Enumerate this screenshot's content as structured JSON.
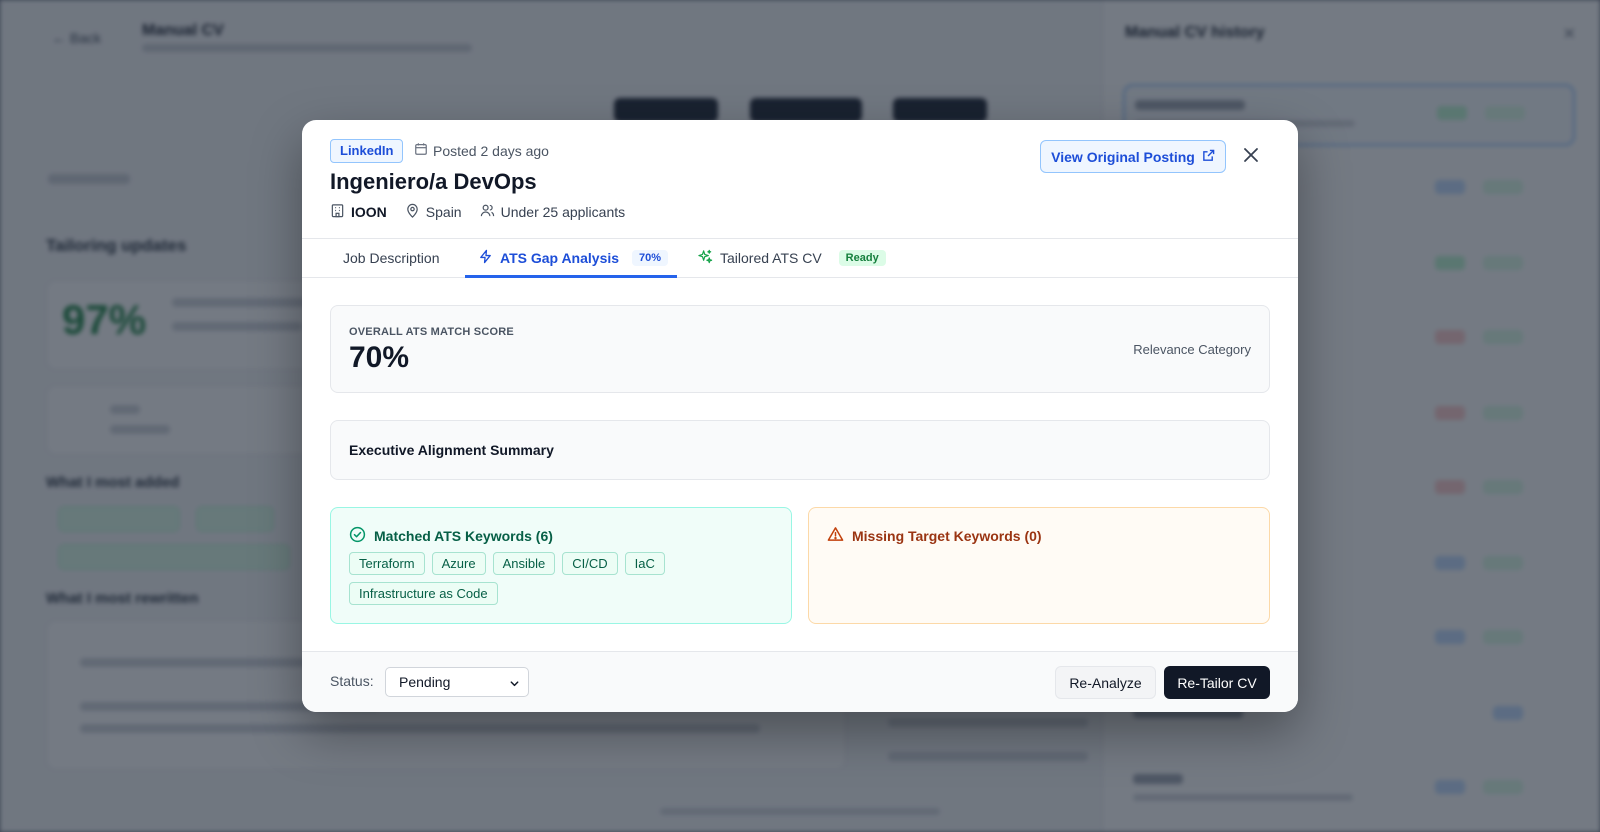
{
  "modal": {
    "source_badge": "LinkedIn",
    "posted": "Posted 2 days ago",
    "job_title": "Ingeniero/a DevOps",
    "company": "IOON",
    "location": "Spain",
    "applicants": "Under 25 applicants",
    "view_posting_label": "View Original Posting",
    "tabs": [
      {
        "label": "Job Description",
        "icon": "none",
        "active": false
      },
      {
        "label": "ATS Gap Analysis",
        "icon": "bolt-icon",
        "badge": "70%",
        "active": true
      },
      {
        "label": "Tailored ATS CV",
        "icon": "sparkles-icon",
        "badge": "Ready",
        "active": false
      }
    ],
    "score": {
      "label": "OVERALL ATS MATCH SCORE",
      "value": "70%",
      "relevance_label": "Relevance Category"
    },
    "summary_title": "Executive Alignment Summary",
    "matched": {
      "title": "Matched ATS Keywords (6)",
      "keywords": [
        "Terraform",
        "Azure",
        "Ansible",
        "CI/CD",
        "IaC",
        "Infrastructure as Code"
      ]
    },
    "missing": {
      "title": "Missing Target Keywords (0)",
      "keywords": []
    },
    "footer": {
      "status_label": "Status:",
      "status_value": "Pending",
      "reanalyze_label": "Re-Analyze",
      "retailor_label": "Re-Tailor CV"
    }
  },
  "colors": {
    "accent": "#1d4ed8",
    "matched_bg": "#f0fdf9",
    "missing_bg": "#fffbf5",
    "primary_button": "#111827"
  }
}
